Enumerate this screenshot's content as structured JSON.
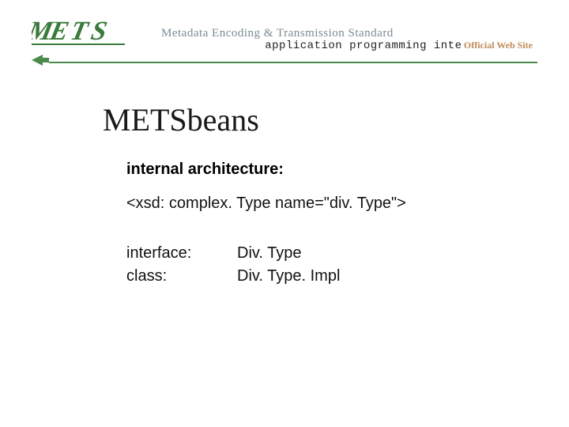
{
  "header": {
    "logo_text": "METS",
    "standard_text": "Metadata Encoding & Transmission Standard",
    "api_label": "application programming interface",
    "official_text": "Official Web Site"
  },
  "content": {
    "title": "METSbeans",
    "subtitle": "internal architecture:",
    "xsd_line": "<xsd: complex. Type name=\"div. Type\">",
    "rows": [
      {
        "key": "interface:",
        "val": "Div. Type"
      },
      {
        "key": "class:",
        "val": "Div. Type. Impl"
      }
    ]
  }
}
